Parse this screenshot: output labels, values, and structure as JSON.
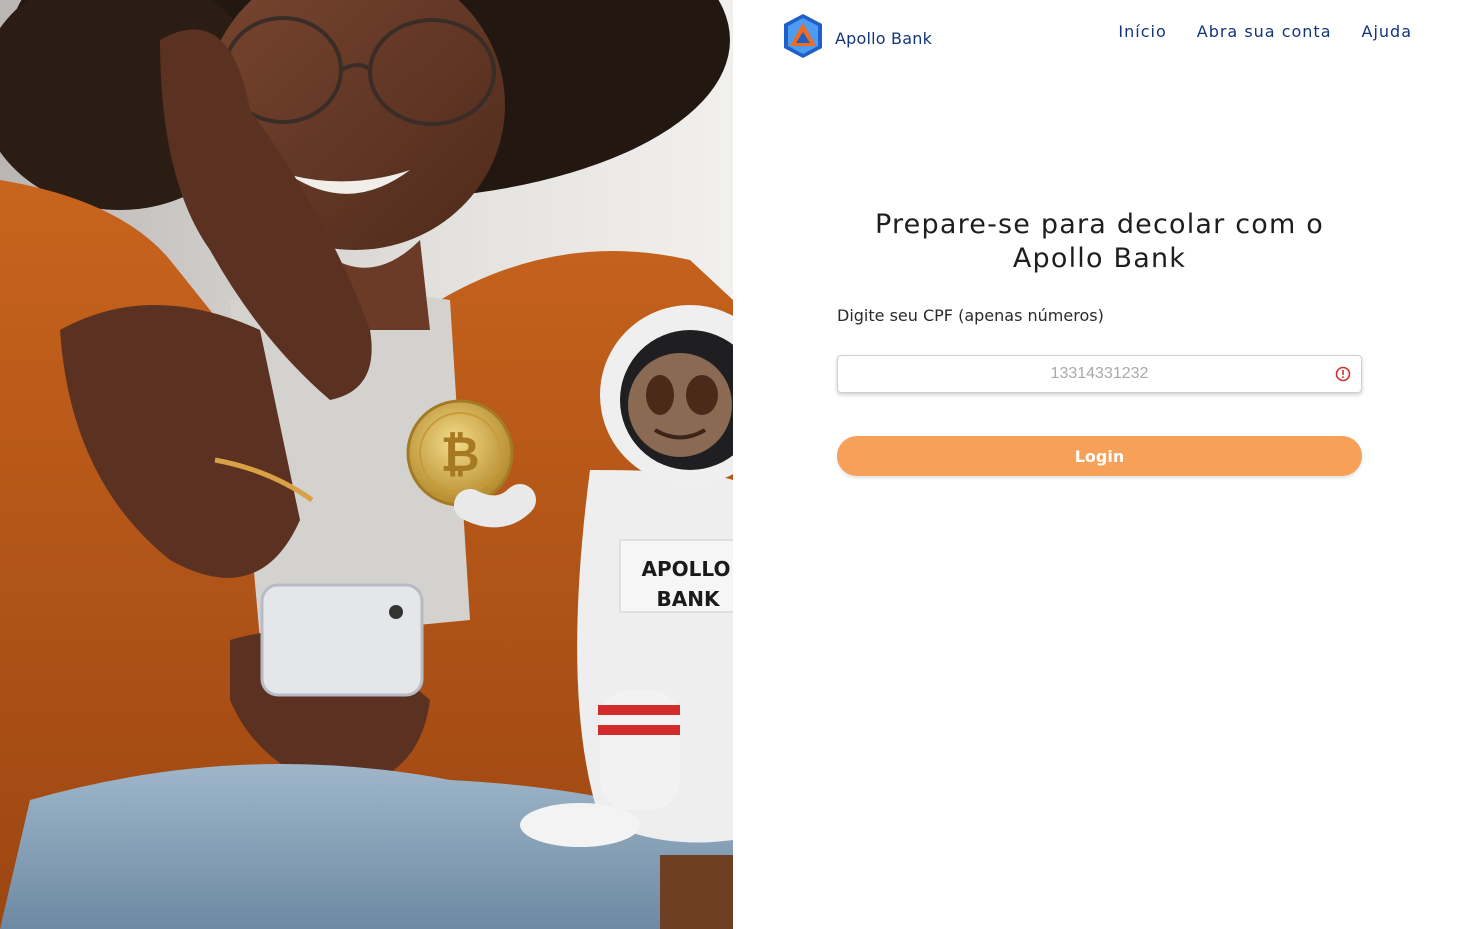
{
  "header": {
    "brand_name": "Apollo Bank",
    "nav": [
      {
        "label": "Início"
      },
      {
        "label": "Abra sua conta"
      },
      {
        "label": "Ajuda"
      }
    ]
  },
  "hero": {
    "badge_line1": "APOLLO",
    "badge_line2": "BANK"
  },
  "form": {
    "title": "Prepare-se para decolar com o Apollo Bank",
    "cpf_label": "Digite seu CPF (apenas números)",
    "cpf_placeholder": "13314331232",
    "cpf_value": "",
    "login_label": "Login"
  },
  "colors": {
    "brand_navy": "#13357a",
    "button_orange": "#f7a058",
    "alert_red": "#d32f2f"
  },
  "icons": {
    "logo": "apollo-bank-logo-icon",
    "input_status": "alert-circle-icon"
  }
}
